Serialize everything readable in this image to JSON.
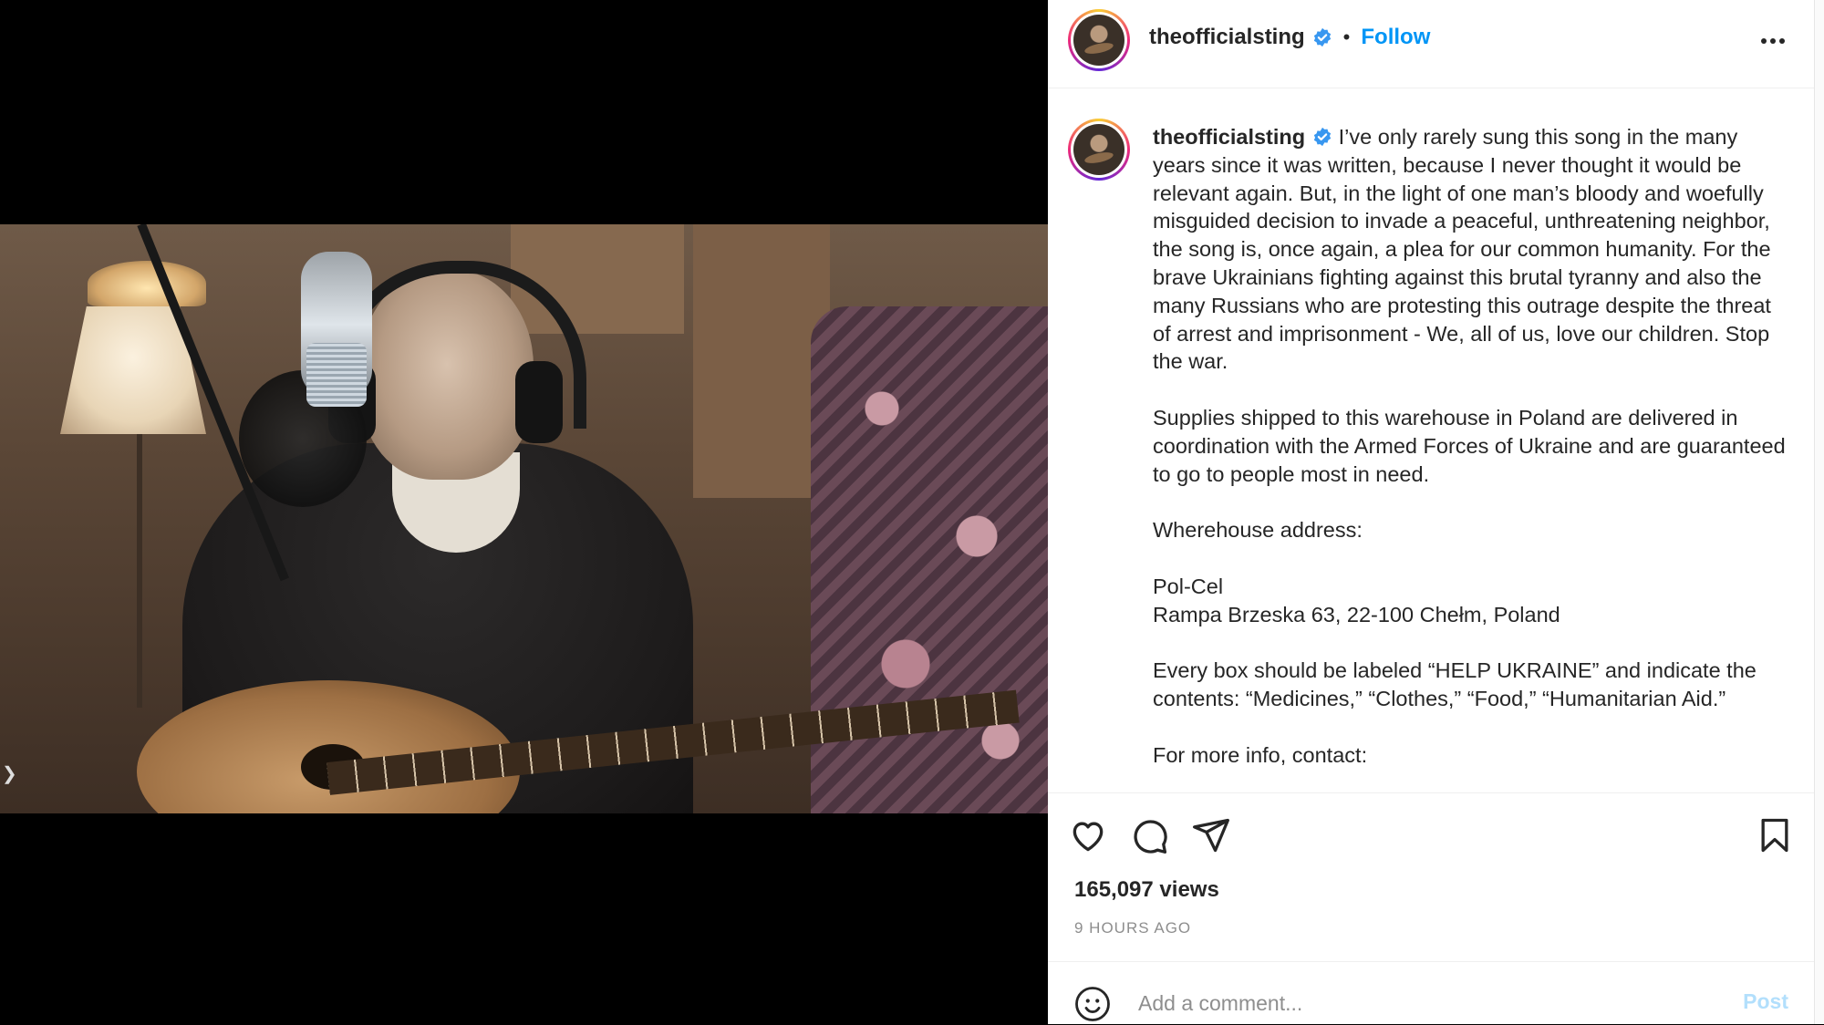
{
  "post": {
    "username": "theofficialsting",
    "verified": true,
    "separator": "•",
    "follow_label": "Follow",
    "more_icon": "more-horizontal-icon"
  },
  "caption": {
    "username": "theofficialsting",
    "text": " I’ve only rarely sung this song in the many years since it was written, because I never thought it would be relevant again. But, in the light of one man’s bloody and woefully misguided decision to invade a peaceful, unthreatening neighbor, the song is, once again, a plea for our common humanity. For the brave Ukrainians fighting against this brutal tyranny and also the many Russians who are protesting this outrage despite the threat of arrest and imprisonment - We, all of us, love our children. Stop the war.\n\nSupplies shipped to this warehouse in Poland are delivered in coordination with the Armed Forces of Ukraine and are guaranteed to go to people most in need.\n\nWherehouse address:\n\nPol-Cel\nRampa Brzeska 63, 22-100 Chełm, Poland\n\nEvery box should be labeled “HELP UKRAINE” and indicate the contents: “Medicines,” “Clothes,” “Food,” “Humanitarian Aid.”\n\nFor more info, contact:"
  },
  "actions": {
    "like_icon": "heart-icon",
    "comment_icon": "comment-icon",
    "share_icon": "paper-plane-icon",
    "save_icon": "bookmark-icon"
  },
  "stats": {
    "views": "165,097 views",
    "time_ago": "9 HOURS AGO"
  },
  "comment": {
    "placeholder": "Add a comment...",
    "post_label": "Post"
  },
  "colors": {
    "link": "#0095f6",
    "verified": "#3897f0",
    "post_disabled": "#b2dffc"
  }
}
